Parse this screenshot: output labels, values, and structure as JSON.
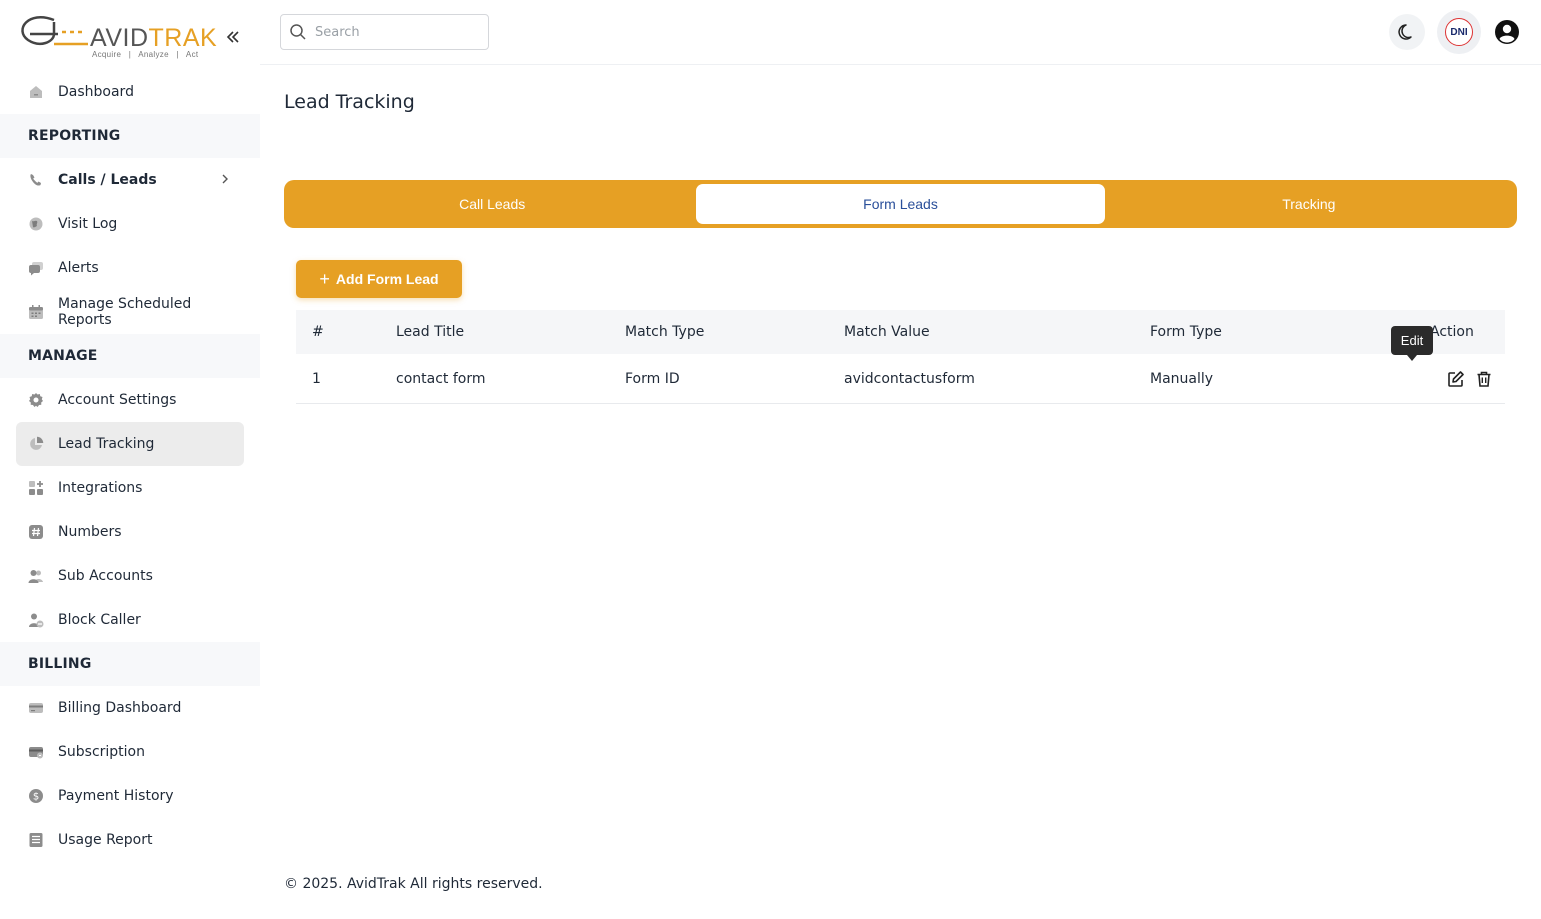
{
  "brand": {
    "word_left": "AVID",
    "word_right": "TRAK",
    "tagline": "Acquire   |   Analyze   |   Act",
    "accent_color": "#e6a024"
  },
  "sidebar": {
    "top_items": [
      {
        "label": "Dashboard",
        "icon": "home-icon"
      }
    ],
    "sections": [
      {
        "title": "REPORTING",
        "items": [
          {
            "label": "Calls / Leads",
            "icon": "phone-icon"
          },
          {
            "label": "Visit Log",
            "icon": "globe-icon"
          },
          {
            "label": "Alerts",
            "icon": "chat-bubble-icon"
          },
          {
            "label": "Manage Scheduled Reports",
            "icon": "calendar-icon"
          }
        ]
      },
      {
        "title": "MANAGE",
        "items": [
          {
            "label": "Account Settings",
            "icon": "gear-icon"
          },
          {
            "label": "Lead Tracking",
            "icon": "pie-chart-icon"
          },
          {
            "label": "Integrations",
            "icon": "grid-plus-icon"
          },
          {
            "label": "Numbers",
            "icon": "hash-icon"
          },
          {
            "label": "Sub Accounts",
            "icon": "users-icon"
          },
          {
            "label": "Block Caller",
            "icon": "user-block-icon"
          }
        ]
      },
      {
        "title": "BILLING",
        "items": [
          {
            "label": "Billing Dashboard",
            "icon": "credit-card-icon"
          },
          {
            "label": "Subscription",
            "icon": "card-subscription-icon"
          },
          {
            "label": "Payment History",
            "icon": "dollar-circle-icon"
          },
          {
            "label": "Usage Report",
            "icon": "report-list-icon"
          }
        ]
      }
    ]
  },
  "topbar": {
    "search_placeholder": "Search",
    "dni_label": "DNI"
  },
  "page": {
    "title": "Lead Tracking",
    "tabs": [
      "Call Leads",
      "Form Leads",
      "Tracking"
    ],
    "active_tab": "Form Leads",
    "add_button": "Add Form Lead"
  },
  "table": {
    "headers": [
      "#",
      "Lead Title",
      "Match Type",
      "Match Value",
      "Form Type",
      "Action"
    ],
    "rows": [
      {
        "num": "1",
        "title": "contact form",
        "match_type": "Form ID",
        "match_value": "avidcontactusform",
        "form_type": "Manually"
      }
    ]
  },
  "tooltip": {
    "text": "Edit"
  },
  "footer": {
    "text": "© 2025. AvidTrak All rights reserved."
  }
}
